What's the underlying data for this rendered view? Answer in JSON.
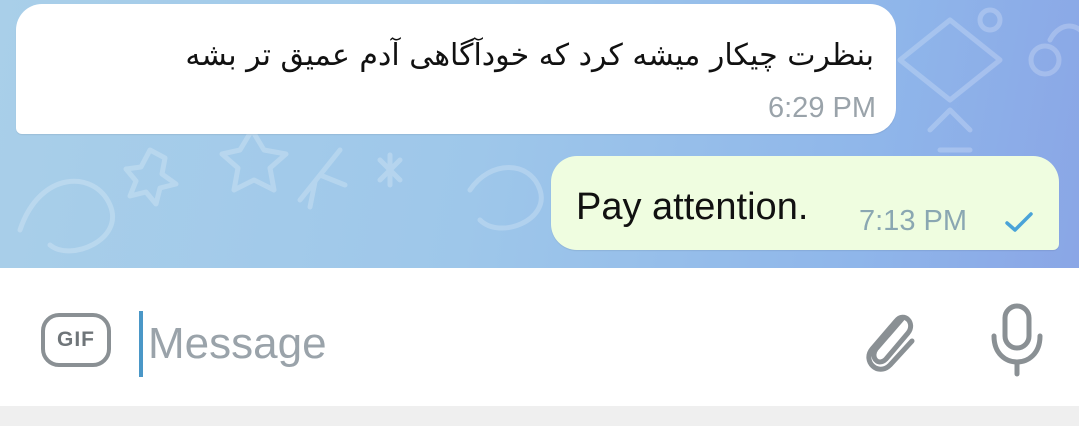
{
  "messages": [
    {
      "direction": "incoming",
      "text": "بنظرت چیکار میشه کرد که خودآگاهی آدم عمیق تر بشه",
      "time": "6:29 PM"
    },
    {
      "direction": "outgoing",
      "text": "Pay attention.",
      "time": "7:13 PM",
      "status": "sent-check-icon"
    }
  ],
  "composer": {
    "gif_label": "GIF",
    "placeholder": "Message",
    "value": "",
    "attach_icon": "paperclip-icon",
    "mic_icon": "microphone-icon"
  },
  "colors": {
    "incoming_bubble": "#ffffff",
    "outgoing_bubble": "#effde0",
    "check": "#4aa3d8",
    "cursor": "#4a97c7",
    "wallpaper_start": "#a9cfe9",
    "wallpaper_end": "#8aa6e6"
  }
}
